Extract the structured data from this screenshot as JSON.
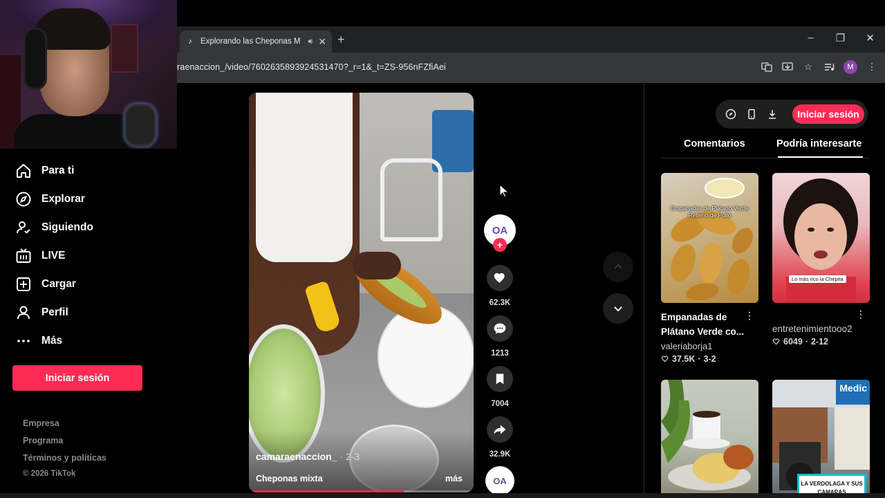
{
  "browser": {
    "tab_title": "Explorando las Cheponas M",
    "tab_favicon": "tiktok-icon",
    "url": "raenaccion_/video/7602635893924531470?_r=1&_t=ZS-956nFZfiAei",
    "avatar_letter": "M",
    "window_controls": [
      "–",
      "❐",
      "✕"
    ]
  },
  "sidebar": {
    "items": [
      {
        "label": "Para ti",
        "icon": "home-icon"
      },
      {
        "label": "Explorar",
        "icon": "compass-icon"
      },
      {
        "label": "Siguiendo",
        "icon": "following-icon"
      },
      {
        "label": "LIVE",
        "icon": "live-icon"
      },
      {
        "label": "Cargar",
        "icon": "upload-icon"
      },
      {
        "label": "Perfil",
        "icon": "profile-icon"
      },
      {
        "label": "Más",
        "icon": "more-icon"
      }
    ],
    "login_label": "Iniciar sesión",
    "footer": [
      "Empresa",
      "Programa",
      "Términos y políticas"
    ],
    "copyright": "© 2026 TikTok"
  },
  "video": {
    "author": "camaraenaccion_",
    "author_suffix": "· 2-3",
    "caption": "Cheponas mixta",
    "more_label": "más",
    "progress": 0.69,
    "avatar_text": "OA"
  },
  "actions": {
    "likes": "62.3K",
    "comments": "1213",
    "saves": "7004",
    "shares": "32.9K"
  },
  "right_panel": {
    "login_label": "Iniciar sesión",
    "tabs": [
      "Comentarios",
      "Podría interesarte"
    ],
    "active_tab": "Podría interesarte",
    "cards": [
      {
        "title": "Empanadas de Plátano Verde co...",
        "user": "valeriaborja1",
        "likes": "37.5K",
        "date": "3-2",
        "overlay": "Empanadas de Plátano Verde Relleno de Pollo"
      },
      {
        "title": "",
        "user": "entretenimientooo2",
        "likes": "6049",
        "date": "2-12",
        "overlay": "Lo más rico la Chepita"
      },
      {
        "overlay": ""
      },
      {
        "overlay": "LA VERDOLAGA Y SUS CAMARAS",
        "sign": "Medic"
      }
    ]
  },
  "colors": {
    "accent": "#fe2c55",
    "background": "#000000",
    "chrome": "#35363a"
  }
}
